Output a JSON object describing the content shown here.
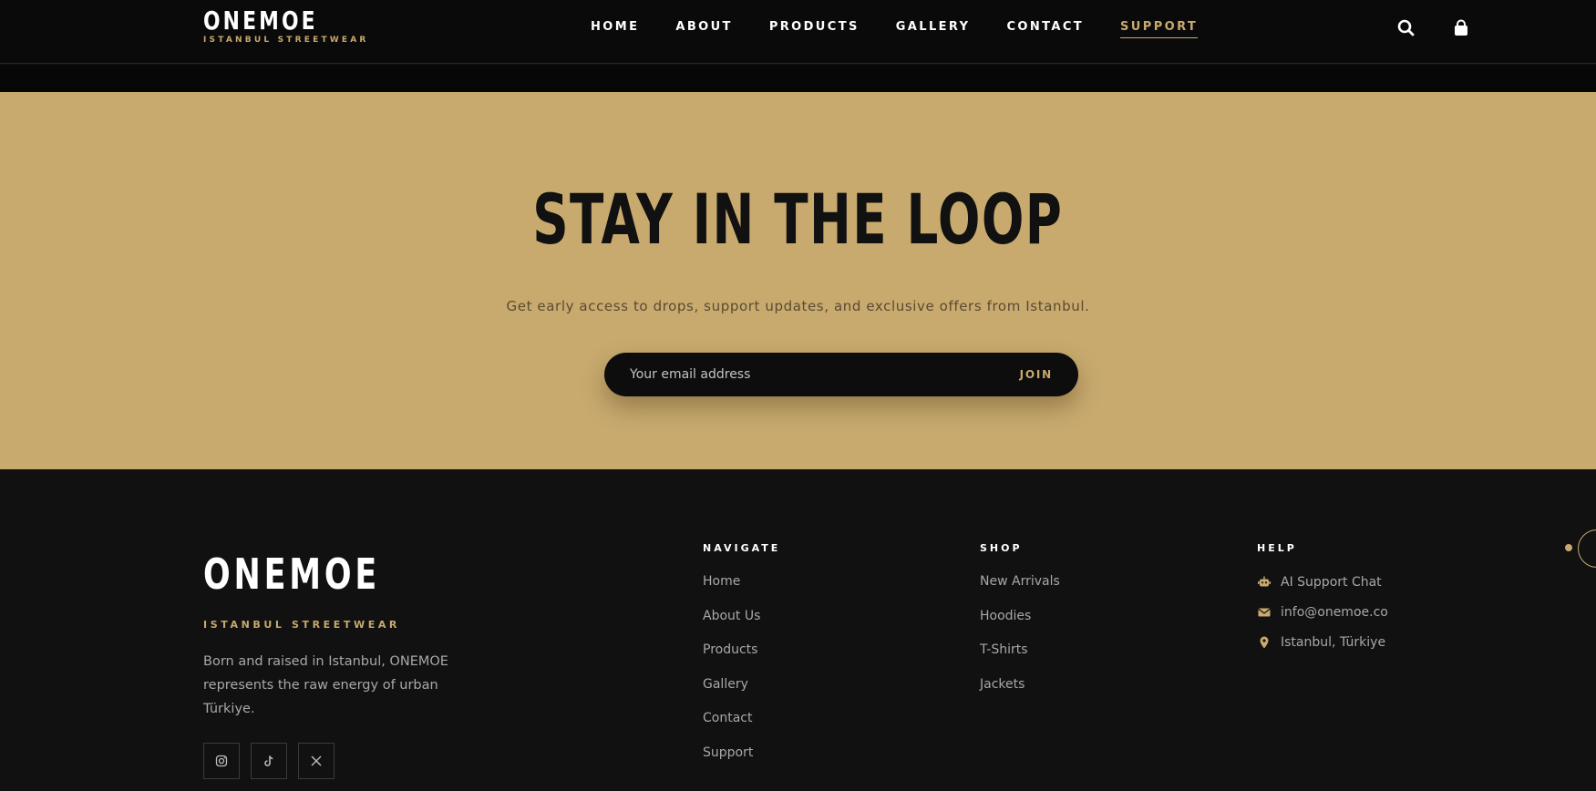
{
  "header": {
    "brand": "ONEMOE",
    "tagline": "ISTANBUL STREETWEAR",
    "nav": [
      "HOME",
      "ABOUT",
      "PRODUCTS",
      "GALLERY",
      "CONTACT",
      "SUPPORT"
    ],
    "active_nav": "SUPPORT",
    "icons": [
      "search-icon",
      "bag-icon"
    ]
  },
  "newsletter": {
    "title": "STAY IN THE LOOP",
    "subtitle": "Get early access to drops, support updates, and exclusive offers from Istanbul.",
    "email_placeholder": "Your email address",
    "join_label": "JOIN"
  },
  "footer": {
    "brand": "ONEMOE",
    "tagline": "ISTANBUL STREETWEAR",
    "description": "Born and raised in Istanbul, ONEMOE represents the raw energy of urban Türkiye.",
    "social_icons": [
      "instagram-icon",
      "tiktok-icon",
      "x-icon"
    ],
    "navigate": {
      "heading": "NAVIGATE",
      "links": [
        "Home",
        "About Us",
        "Products",
        "Gallery",
        "Contact",
        "Support"
      ]
    },
    "shop": {
      "heading": "SHOP",
      "links": [
        "New Arrivals",
        "Hoodies",
        "T-Shirts",
        "Jackets"
      ]
    },
    "help": {
      "heading": "HELP",
      "items": [
        {
          "icon": "robot-icon",
          "text": "AI Support Chat"
        },
        {
          "icon": "envelope-icon",
          "text": "info@onemoe.co"
        },
        {
          "icon": "map-pin-icon",
          "text": "Istanbul, Türkiye"
        }
      ]
    }
  },
  "colors": {
    "accent": "#c9a96e",
    "newsletter_bg": "#c8aa6f",
    "header_bg": "#0a0a0a",
    "footer_bg": "#111111"
  }
}
